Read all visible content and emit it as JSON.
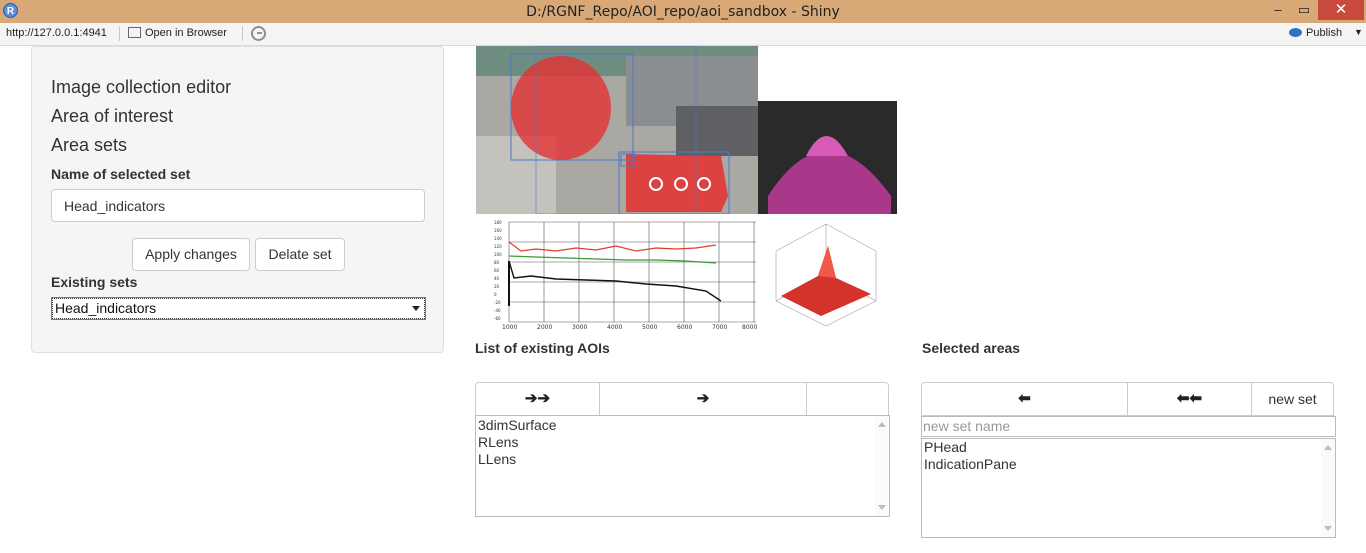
{
  "window": {
    "title": "D:/RGNF_Repo/AOI_repo/aoi_sandbox - Shiny",
    "app_icon": "R",
    "minimize": "–",
    "restore": "▭",
    "close": "✕"
  },
  "toolbar": {
    "url": "http://127.0.0.1:4941",
    "open_in_browser": "Open in Browser",
    "publish": "Publish"
  },
  "sidebar": {
    "link_image_collection": "Image collection editor",
    "link_area_of_interest": "Area of interest",
    "link_area_sets": "Area sets",
    "name_label": "Name of selected set",
    "name_value": "Head_indicators",
    "apply_button": "Apply changes",
    "delete_button": "Delate set",
    "existing_label": "Existing sets",
    "existing_selected": "Head_indicators"
  },
  "aoi_list": {
    "title": "List of existing AOIs",
    "buttons": [
      "➔➔",
      "➔",
      ""
    ],
    "items": [
      "3dimSurface",
      "RLens",
      "LLens"
    ]
  },
  "selected_areas": {
    "title": "Selected areas",
    "buttons": [
      "⬅",
      "⬅⬅",
      "new set"
    ],
    "new_set_placeholder": "new set name",
    "items": [
      "PHead",
      "IndicationPane"
    ]
  },
  "plot": {
    "y_ticks": [
      "180",
      "160",
      "140",
      "120",
      "100",
      "80",
      "60",
      "40",
      "20",
      "0",
      "-20",
      "-40",
      "-60"
    ],
    "x_ticks": [
      "1000",
      "2000",
      "3000",
      "4000",
      "5000",
      "6000",
      "7000",
      "8000"
    ]
  },
  "colors": {
    "titlebar": "#d9a877",
    "aoi_red": "#e5302f",
    "magenta": "#c0399b",
    "aoi_box": "#4a78d0"
  },
  "icons": [
    "r-logo-icon",
    "open-browser-icon",
    "refresh-icon",
    "publish-icon",
    "dropdown-arrow-icon",
    "double-right-arrow-icon",
    "right-arrow-icon",
    "left-arrow-icon",
    "double-left-arrow-icon"
  ]
}
